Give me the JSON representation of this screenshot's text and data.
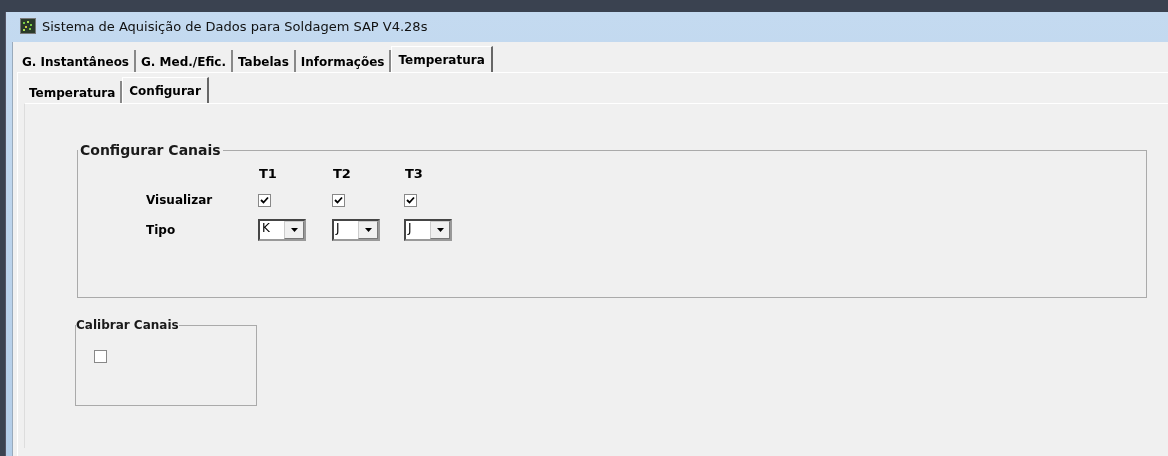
{
  "window": {
    "title": "Sistema de Aquisição de Dados para Soldagem  SAP V4.28s"
  },
  "tabs": [
    {
      "label": "G. Instantâneos",
      "selected": false
    },
    {
      "label": "G.  Med./Efic.",
      "selected": false
    },
    {
      "label": "Tabelas",
      "selected": false
    },
    {
      "label": "Informações",
      "selected": false
    },
    {
      "label": "Temperatura",
      "selected": true
    }
  ],
  "subtabs": [
    {
      "label": "Temperatura",
      "selected": false
    },
    {
      "label": "Configurar",
      "selected": true
    }
  ],
  "configure_channels": {
    "title": "Configurar Canais",
    "row_labels": [
      "Visualizar",
      "Tipo"
    ],
    "channels": [
      {
        "name": "T1",
        "visible": true,
        "type": "K"
      },
      {
        "name": "T2",
        "visible": true,
        "type": "J"
      },
      {
        "name": "T3",
        "visible": true,
        "type": "J"
      }
    ]
  },
  "calibrate_channels": {
    "title": "Calibrar Canais",
    "checked": false
  }
}
